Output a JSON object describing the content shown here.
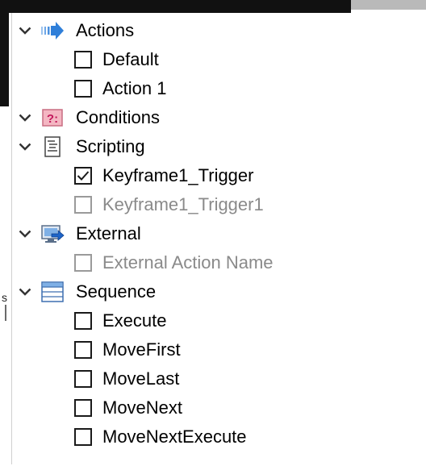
{
  "tree": {
    "actions": {
      "label": "Actions",
      "icon": "blue-arrow-icon",
      "children": [
        {
          "label": "Default",
          "checked": false,
          "enabled": true
        },
        {
          "label": "Action 1",
          "checked": false,
          "enabled": true
        }
      ]
    },
    "conditions": {
      "label": "Conditions",
      "icon": "conditions-icon",
      "icon_text": "?:"
    },
    "scripting": {
      "label": "Scripting",
      "icon": "script-icon",
      "children": [
        {
          "label": "Keyframe1_Trigger",
          "checked": true,
          "enabled": true
        },
        {
          "label": "Keyframe1_Trigger1",
          "checked": false,
          "enabled": false
        }
      ]
    },
    "external": {
      "label": "External",
      "icon": "external-icon",
      "children": [
        {
          "label": "External Action Name",
          "checked": false,
          "enabled": false
        }
      ]
    },
    "sequence": {
      "label": "Sequence",
      "icon": "sequence-icon",
      "children": [
        {
          "label": "Execute",
          "checked": false,
          "enabled": true
        },
        {
          "label": "MoveFirst",
          "checked": false,
          "enabled": true
        },
        {
          "label": "MoveLast",
          "checked": false,
          "enabled": true
        },
        {
          "label": "MoveNext",
          "checked": false,
          "enabled": true
        },
        {
          "label": "MoveNextExecute",
          "checked": false,
          "enabled": true
        }
      ]
    }
  },
  "background_fragment": "s",
  "colors": {
    "accent_blue": "#2f7fd9",
    "conditions_pink": "#f4b6c2",
    "conditions_text": "#c2185b",
    "disabled_text": "#8a8a8a"
  }
}
